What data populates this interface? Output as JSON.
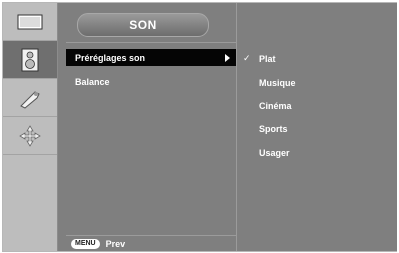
{
  "sidebar": {
    "items": [
      {
        "icon": "picture-icon",
        "active": false
      },
      {
        "icon": "speaker-icon",
        "active": true
      },
      {
        "icon": "settings-tool-icon",
        "active": false
      },
      {
        "icon": "arrows-icon",
        "active": false
      }
    ]
  },
  "menu": {
    "title": "SON",
    "items": [
      {
        "label": "Préréglages son",
        "selected": true,
        "has_submenu": true
      },
      {
        "label": "Balance",
        "selected": false,
        "has_submenu": false
      }
    ]
  },
  "submenu": {
    "items": [
      {
        "label": "Plat",
        "checked": true
      },
      {
        "label": "Musique",
        "checked": false
      },
      {
        "label": "Cinéma",
        "checked": false
      },
      {
        "label": "Sports",
        "checked": false
      },
      {
        "label": "Usager",
        "checked": false
      }
    ],
    "check_mark": "✓"
  },
  "footer": {
    "key_label": "MENU",
    "action_label": "Prev"
  },
  "colors": {
    "panel": "#7f7f7f",
    "sidebar": "#bdbdbd",
    "selected_row": "#050505",
    "text": "#ffffff"
  }
}
